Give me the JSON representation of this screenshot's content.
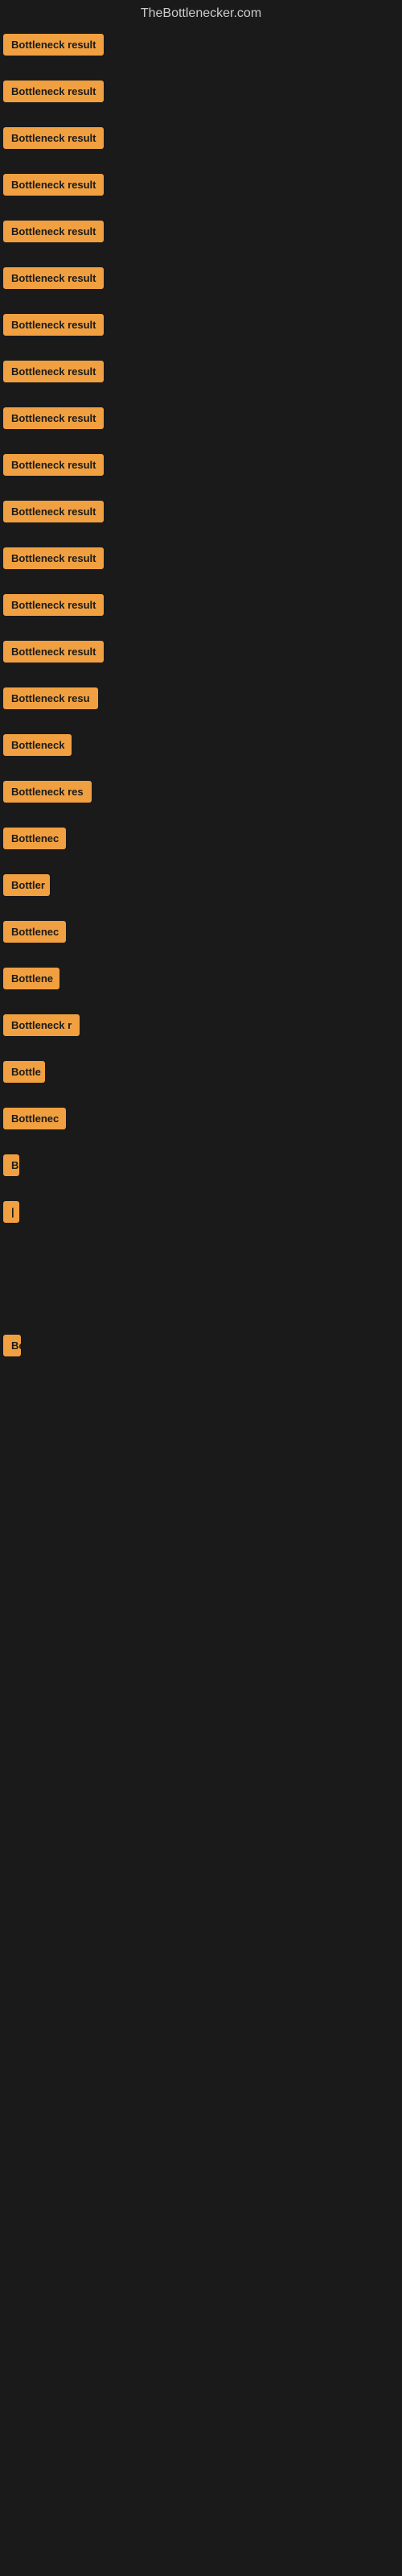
{
  "site": {
    "title": "TheBottlenecker.com"
  },
  "items": [
    {
      "label": "Bottleneck result",
      "width": 140
    },
    {
      "label": "Bottleneck result",
      "width": 140
    },
    {
      "label": "Bottleneck result",
      "width": 140
    },
    {
      "label": "Bottleneck result",
      "width": 140
    },
    {
      "label": "Bottleneck result",
      "width": 140
    },
    {
      "label": "Bottleneck result",
      "width": 140
    },
    {
      "label": "Bottleneck result",
      "width": 140
    },
    {
      "label": "Bottleneck result",
      "width": 140
    },
    {
      "label": "Bottleneck result",
      "width": 140
    },
    {
      "label": "Bottleneck result",
      "width": 140
    },
    {
      "label": "Bottleneck result",
      "width": 140
    },
    {
      "label": "Bottleneck result",
      "width": 140
    },
    {
      "label": "Bottleneck result",
      "width": 140
    },
    {
      "label": "Bottleneck result",
      "width": 140
    },
    {
      "label": "Bottleneck resu",
      "width": 126
    },
    {
      "label": "Bottleneck",
      "width": 85
    },
    {
      "label": "Bottleneck res",
      "width": 112
    },
    {
      "label": "Bottlenec",
      "width": 78
    },
    {
      "label": "Bottler",
      "width": 58
    },
    {
      "label": "Bottlenec",
      "width": 78
    },
    {
      "label": "Bottlene",
      "width": 70
    },
    {
      "label": "Bottleneck r",
      "width": 96
    },
    {
      "label": "Bottle",
      "width": 52
    },
    {
      "label": "Bottlenec",
      "width": 78
    },
    {
      "label": "B",
      "width": 18
    },
    {
      "label": "|",
      "width": 10
    },
    {
      "label": "",
      "width": 0
    },
    {
      "label": "",
      "width": 0
    },
    {
      "label": "",
      "width": 0
    },
    {
      "label": "Bo",
      "width": 22
    },
    {
      "label": "",
      "width": 0
    },
    {
      "label": "",
      "width": 0
    },
    {
      "label": "",
      "width": 0
    },
    {
      "label": "",
      "width": 0
    }
  ]
}
